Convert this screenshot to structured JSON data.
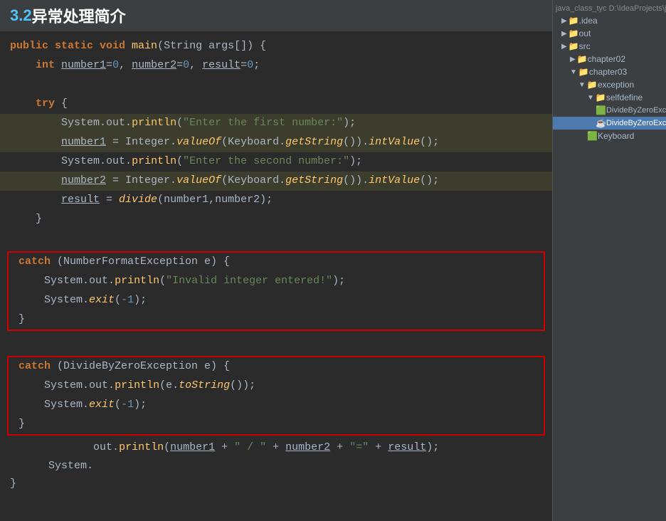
{
  "title": {
    "number": "3.2",
    "text": " 异常处理简介"
  },
  "fileTree": {
    "path": "java_class_tyc  D:\\IdeaProjects\\java_...",
    "items": [
      {
        "label": ".idea",
        "indent": 1,
        "type": "folder",
        "expanded": false
      },
      {
        "label": "out",
        "indent": 1,
        "type": "folder",
        "expanded": false
      },
      {
        "label": "src",
        "indent": 1,
        "type": "folder",
        "expanded": false
      },
      {
        "label": "chapter02",
        "indent": 2,
        "type": "folder",
        "expanded": false
      },
      {
        "label": "chapter03",
        "indent": 2,
        "type": "folder",
        "expanded": true
      },
      {
        "label": "exception",
        "indent": 3,
        "type": "folder",
        "expanded": true
      },
      {
        "label": "selfdefine",
        "indent": 4,
        "type": "folder",
        "expanded": true
      },
      {
        "label": "DivideByZeroExcepti...",
        "indent": 5,
        "type": "class",
        "selected": false
      },
      {
        "label": "DivideByZeroExcepti...",
        "indent": 5,
        "type": "java",
        "selected": true
      },
      {
        "label": "Keyboard",
        "indent": 4,
        "type": "class",
        "selected": false
      }
    ]
  },
  "code": {
    "lines": [
      {
        "id": "l1",
        "content": "public static void main(String args[]) {"
      },
      {
        "id": "l2",
        "content": "    int number1=0, number2=0, result=0;"
      },
      {
        "id": "l3",
        "content": ""
      },
      {
        "id": "l4",
        "content": "    try {"
      },
      {
        "id": "l5",
        "content": "        System.out.println(\"Enter the first number:\");"
      },
      {
        "id": "l6",
        "content": "        number1 = Integer.valueOf(Keyboard.getString()).intValue();"
      },
      {
        "id": "l7",
        "content": "        System.out.println(\"Enter the second number:\");"
      },
      {
        "id": "l8",
        "content": "        number2 = Integer.valueOf(Keyboard.getString()).intValue();"
      },
      {
        "id": "l9",
        "content": "        result = divide(number1,number2);"
      },
      {
        "id": "l10",
        "content": "    }"
      },
      {
        "id": "l11",
        "content": ""
      },
      {
        "id": "c1l1",
        "content": "catch (NumberFormatException e) {"
      },
      {
        "id": "c1l2",
        "content": "    System.out.println(\"Invalid integer entered!\");"
      },
      {
        "id": "c1l3",
        "content": "    System.exit(-1);"
      },
      {
        "id": "c1l4",
        "content": "}"
      },
      {
        "id": "l12",
        "content": ""
      },
      {
        "id": "c2l1",
        "content": "catch (DivideByZeroException e) {"
      },
      {
        "id": "c2l2",
        "content": "    System.out.println(e.toString());"
      },
      {
        "id": "c2l3",
        "content": "    System.exit(-1);"
      },
      {
        "id": "c2l4",
        "content": "}"
      },
      {
        "id": "l13",
        "content": "System.out.println(number1 + \" / \" + number2 + \"=\" + result);"
      },
      {
        "id": "l14",
        "content": "}"
      }
    ]
  }
}
